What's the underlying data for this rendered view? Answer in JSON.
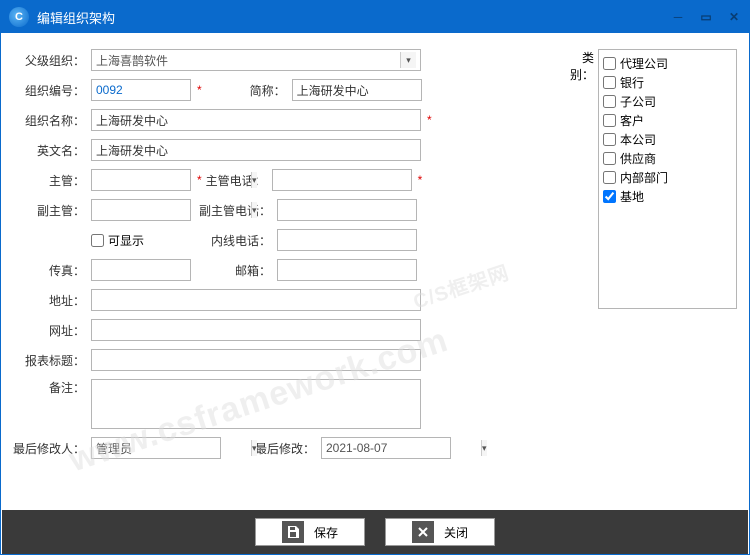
{
  "window": {
    "title": "编辑组织架构"
  },
  "labels": {
    "parent": "父级组织：",
    "code": "组织编号：",
    "short": "简称：",
    "name": "组织名称：",
    "eng": "英文名：",
    "mgr": "主管：",
    "mgrTel": "主管电话：",
    "vmgr": "副主管：",
    "vmgrTel": "副主管电话：",
    "visible": "可显示",
    "inTel": "内线电话：",
    "fax": "传真：",
    "email": "邮箱：",
    "addr": "地址：",
    "web": "网址：",
    "rptTitle": "报表标题：",
    "remark": "备注：",
    "modBy": "最后修改人：",
    "modAt": "最后修改：",
    "category": "类别："
  },
  "values": {
    "parent": "上海喜鹊软件",
    "code": "0092",
    "short": "上海研发中心",
    "name": "上海研发中心",
    "eng": "上海研发中心",
    "mgr": "",
    "mgrTel": "",
    "vmgr": "",
    "vmgrTel": "",
    "inTel": "",
    "fax": "",
    "email": "",
    "addr": "",
    "web": "",
    "rptTitle": "",
    "remark": "",
    "modBy": "管理员",
    "modAt": "2021-08-07"
  },
  "categories": [
    {
      "label": "代理公司",
      "checked": false
    },
    {
      "label": "银行",
      "checked": false
    },
    {
      "label": "子公司",
      "checked": false
    },
    {
      "label": "客户",
      "checked": false
    },
    {
      "label": "本公司",
      "checked": false
    },
    {
      "label": "供应商",
      "checked": false
    },
    {
      "label": "内部部门",
      "checked": false
    },
    {
      "label": "基地",
      "checked": true
    }
  ],
  "buttons": {
    "save": "保存",
    "close": "关闭"
  },
  "watermark": {
    "a": "www.csframework.com",
    "b": "C/S框架网"
  }
}
